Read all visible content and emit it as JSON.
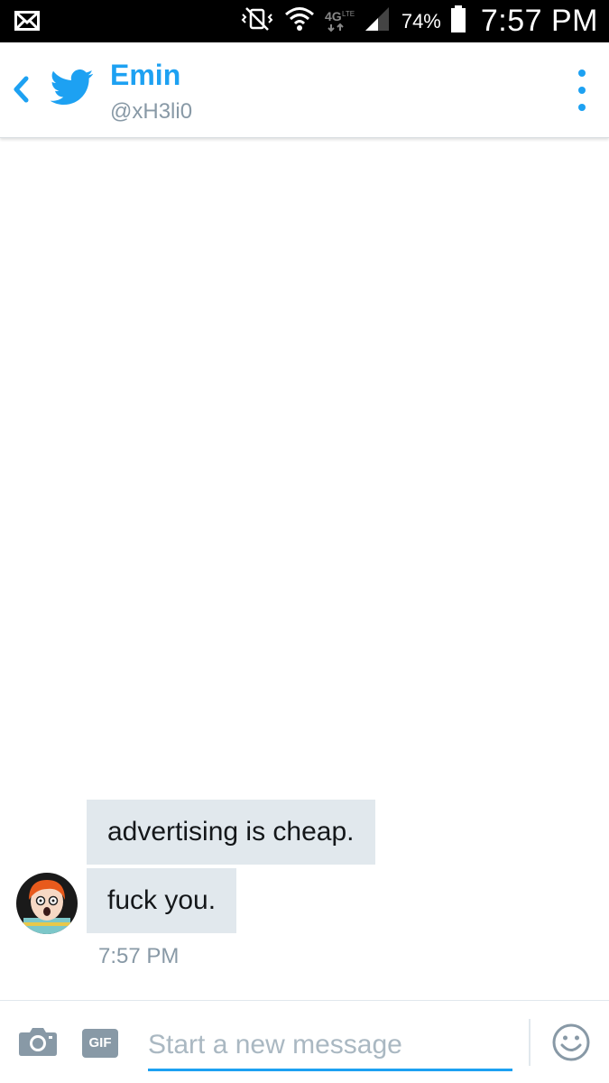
{
  "status_bar": {
    "battery_percent": "74%",
    "time": "7:57 PM"
  },
  "header": {
    "contact_name": "Emin",
    "contact_handle": "@xH3li0"
  },
  "messages": [
    {
      "text": "advertising is cheap."
    },
    {
      "text": "fuck you."
    }
  ],
  "message_time": "7:57 PM",
  "composer": {
    "gif_label": "GIF",
    "placeholder": "Start a new message"
  },
  "colors": {
    "accent": "#1da1f2",
    "bubble": "#e1e8ed",
    "muted_text": "#8899a6"
  }
}
